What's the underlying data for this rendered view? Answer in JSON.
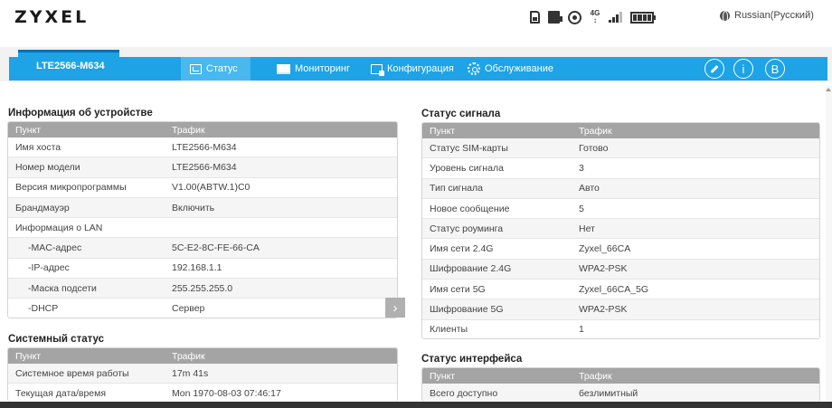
{
  "brand": "ZYXEL",
  "header": {
    "status_icons": [
      "sim-icon",
      "sd-card-icon",
      "wifi-icon",
      "network-4g-icon",
      "signal-bars-icon",
      "battery-icon"
    ],
    "network_type": "4G",
    "language": "Russian(Русский)"
  },
  "nav": {
    "model": "LTE2566-M634",
    "items": [
      {
        "label": "Статус",
        "icon": "status-icon"
      },
      {
        "label": "Мониторинг",
        "icon": "monitor-icon"
      },
      {
        "label": "Конфигурация",
        "icon": "config-icon"
      },
      {
        "label": "Обслуживание",
        "icon": "gear-icon"
      }
    ],
    "right_buttons": [
      "wizard-icon",
      "info-icon",
      "logout-icon"
    ],
    "info_glyph": "i",
    "logout_glyph": "B"
  },
  "device_info": {
    "title": "Информация об устройстве",
    "col1": "Пункт",
    "col2": "Трафик",
    "rows": [
      {
        "k": "Имя хоста",
        "v": "LTE2566-M634"
      },
      {
        "k": "Номер модели",
        "v": "LTE2566-M634"
      },
      {
        "k": "Версия микропрограммы",
        "v": "V1.00(ABTW.1)C0"
      },
      {
        "k": "Брандмауэр",
        "v": "Включить"
      },
      {
        "k": "Информация о LAN",
        "v": ""
      },
      {
        "k": "-MAC-адрес",
        "v": "5C-E2-8C-FE-66-CA"
      },
      {
        "k": "-IP-адрес",
        "v": "192.168.1.1"
      },
      {
        "k": "-Маска подсети",
        "v": "255.255.255.0"
      },
      {
        "k": "-DHCP",
        "v": "Сервер"
      }
    ]
  },
  "system_status": {
    "title": "Системный статус",
    "col1": "Пункт",
    "col2": "Трафик",
    "rows": [
      {
        "k": "Системное время работы",
        "v": "17m 41s"
      },
      {
        "k": "Текущая дата/время",
        "v": "Mon 1970-08-03 07:46:17"
      }
    ]
  },
  "signal_status": {
    "title": "Статус сигнала",
    "col1": "Пункт",
    "col2": "Трафик",
    "rows": [
      {
        "k": "Статус SIM-карты",
        "v": "Готово"
      },
      {
        "k": "Уровень сигнала",
        "v": "3"
      },
      {
        "k": "Тип сигнала",
        "v": "Авто"
      },
      {
        "k": "Новое сообщение",
        "v": "5"
      },
      {
        "k": "Статус роуминга",
        "v": "Нет"
      },
      {
        "k": "Имя сети 2.4G",
        "v": "Zyxel_66CA"
      },
      {
        "k": "Шифрование 2.4G",
        "v": "WPA2-PSK"
      },
      {
        "k": "Имя сети 5G",
        "v": "Zyxel_66CA_5G"
      },
      {
        "k": "Шифрование 5G",
        "v": "WPA2-PSK"
      },
      {
        "k": "Клиенты",
        "v": "1"
      }
    ]
  },
  "interface_status": {
    "title": "Статус интерфейса",
    "col1": "Пункт",
    "col2": "Трафик",
    "rows": [
      {
        "k": "Всего доступно",
        "v": "безлимитный"
      }
    ]
  },
  "colors": {
    "nav": "#1da3e6",
    "nav_active": "#48b8ee",
    "table_head": "#a4a4a4"
  }
}
